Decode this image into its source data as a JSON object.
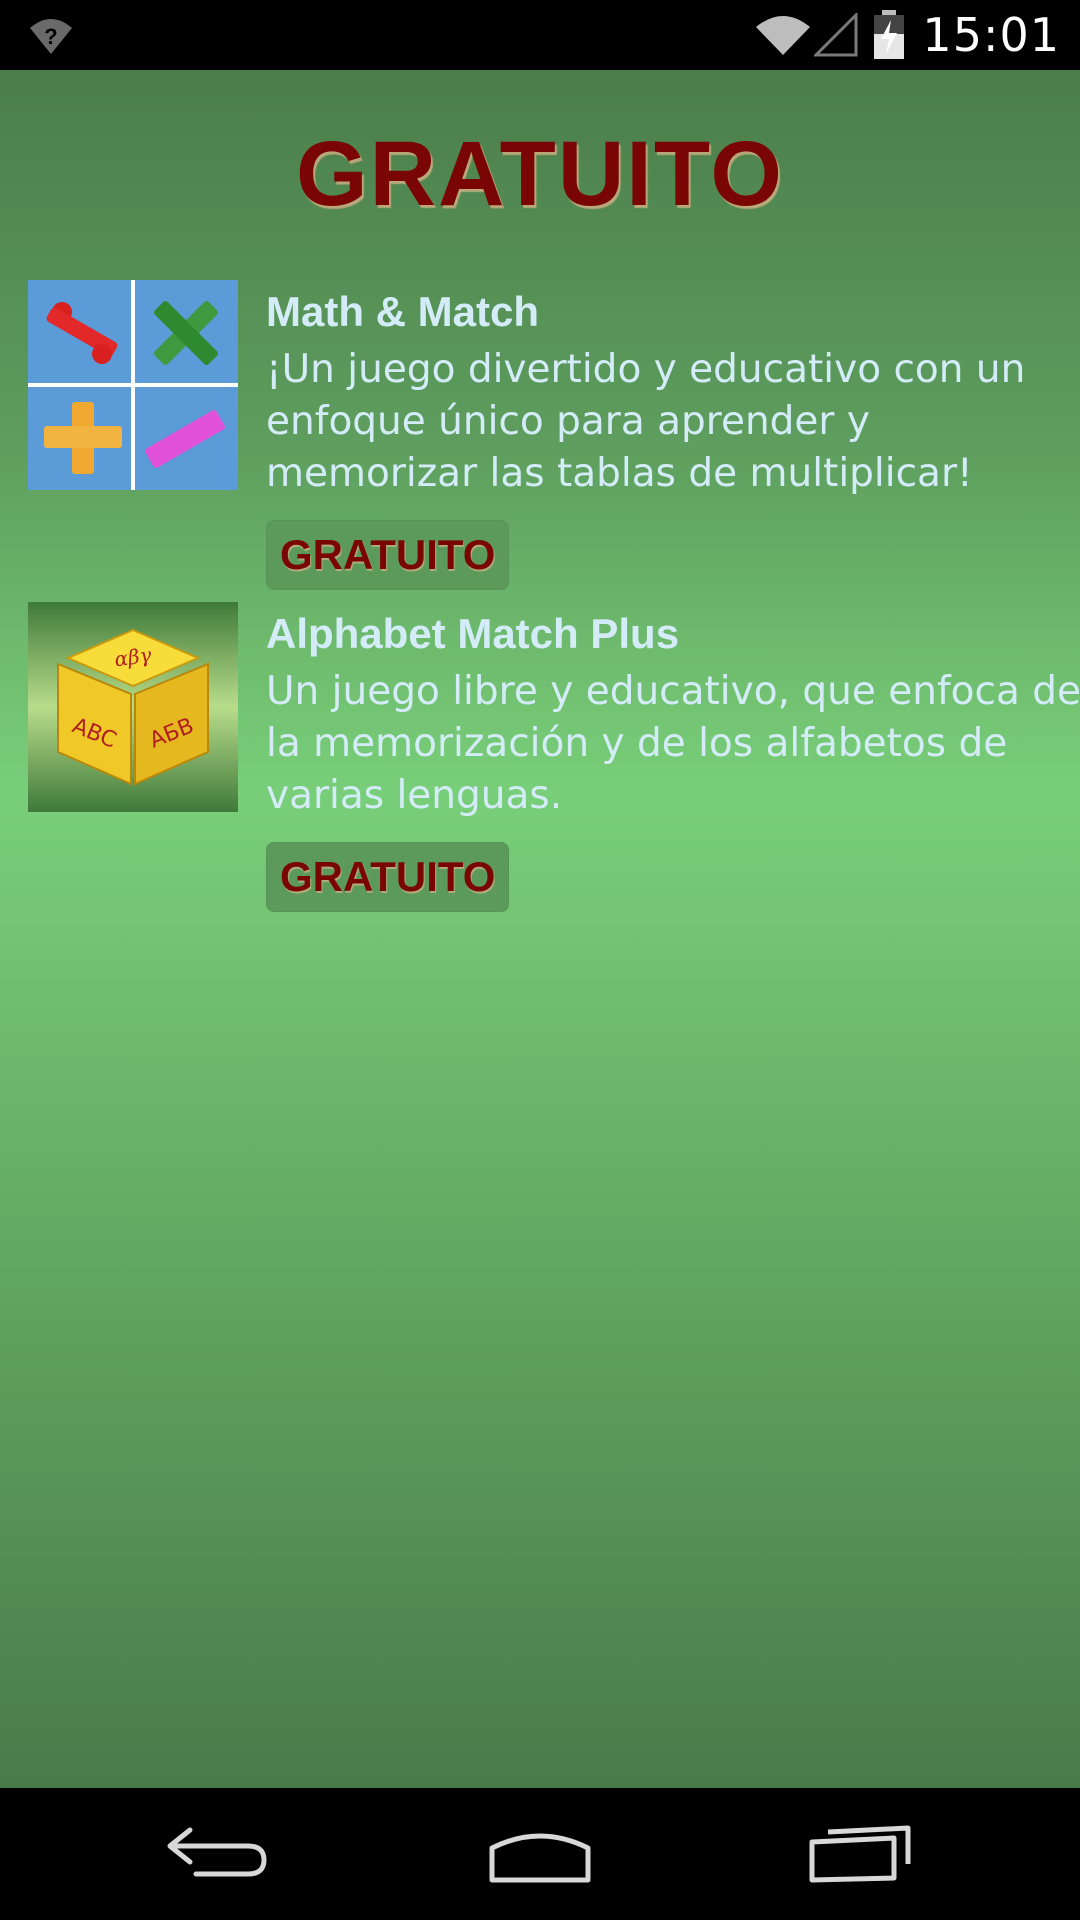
{
  "status_bar": {
    "time": "15:01",
    "icons": [
      "wifi-question-icon",
      "wifi-icon",
      "signal-icon",
      "battery-charging-icon"
    ]
  },
  "page": {
    "title": "GRATUITO"
  },
  "apps": [
    {
      "name": "Math & Match",
      "description": "¡Un juego divertido y educativo con un enfoque único para aprender y memorizar las tablas de multiplicar!",
      "button_label": "GRATUITO",
      "icon": "math-symbols-icon"
    },
    {
      "name": "Alphabet Match Plus",
      "description": "Un juego libre y educativo, que enfoca de la memorización y de los alfabetos de varias lenguas.",
      "button_label": "GRATUITO",
      "icon": "alphabet-cube-icon",
      "icon_text": {
        "top": "αβγ",
        "left": "ABC",
        "right": "AБB"
      }
    }
  ],
  "nav_bar": {
    "icons": [
      "back-icon",
      "home-icon",
      "recents-icon"
    ]
  },
  "colors": {
    "title": "#7a0505",
    "text": "#d4ecf8",
    "button_bg": "#5b9a5b"
  }
}
